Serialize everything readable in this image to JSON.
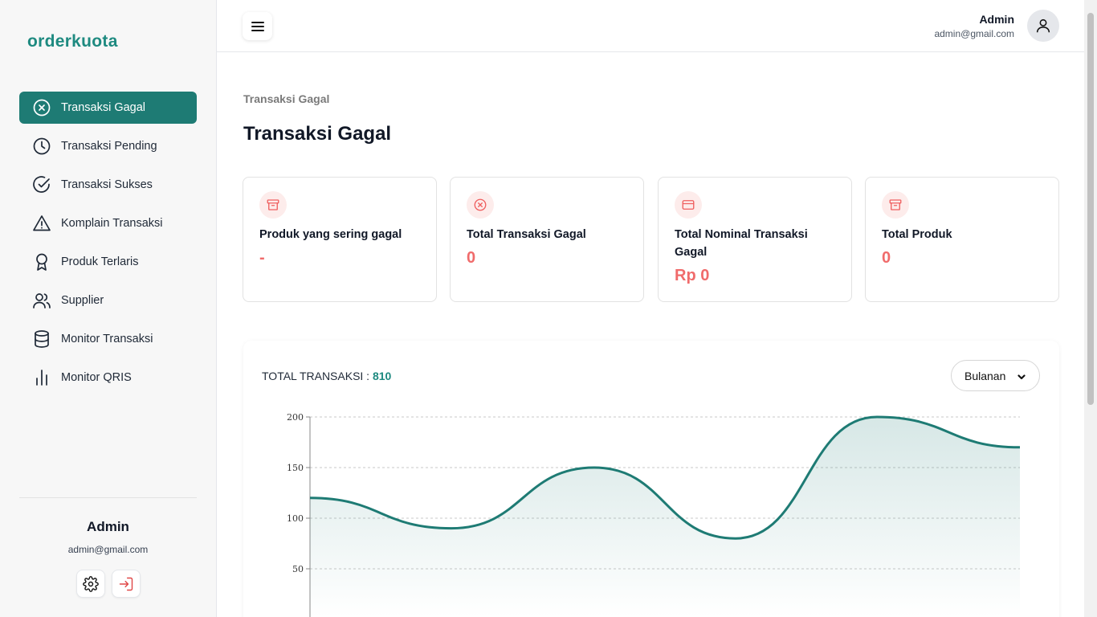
{
  "app": {
    "logo": "orderkuota"
  },
  "sidebar": {
    "items": [
      {
        "label": "Transaksi Gagal",
        "icon": "x-circle-icon",
        "active": true
      },
      {
        "label": "Transaksi Pending",
        "icon": "clock-icon",
        "active": false
      },
      {
        "label": "Transaksi Sukses",
        "icon": "check-circle-icon",
        "active": false
      },
      {
        "label": "Komplain Transaksi",
        "icon": "warning-triangle-icon",
        "active": false
      },
      {
        "label": "Produk Terlaris",
        "icon": "award-icon",
        "active": false
      },
      {
        "label": "Supplier",
        "icon": "users-icon",
        "active": false
      },
      {
        "label": "Monitor Transaksi",
        "icon": "database-icon",
        "active": false
      },
      {
        "label": "Monitor QRIS",
        "icon": "bar-chart-icon",
        "active": false
      }
    ],
    "user": {
      "name": "Admin",
      "email": "admin@gmail.com"
    },
    "accent": "#1e7b74"
  },
  "topbar": {
    "name": "Admin",
    "email": "admin@gmail.com"
  },
  "page": {
    "breadcrumb": "Transaksi Gagal",
    "title": "Transaksi Gagal"
  },
  "cards": [
    {
      "label": "Produk yang sering gagal",
      "value": "-",
      "icon": "archive-icon"
    },
    {
      "label": "Total Transaksi Gagal",
      "value": "0",
      "icon": "x-circle-icon"
    },
    {
      "label": "Total Nominal Transaksi Gagal",
      "value": "Rp 0",
      "icon": "credit-card-icon"
    },
    {
      "label": "Total Produk",
      "value": "0",
      "icon": "archive-icon"
    }
  ],
  "chart_section": {
    "title_prefix": "TOTAL TRANSAKSI : ",
    "total": "810",
    "period_select": "Bulanan"
  },
  "chart_data": {
    "type": "area",
    "x": [
      0,
      1,
      2,
      3,
      4,
      5,
      6
    ],
    "values": [
      120,
      90,
      150,
      80,
      200,
      170
    ],
    "series": [
      {
        "values": [
          120,
          90,
          150,
          80,
          200,
          170
        ]
      }
    ],
    "y_ticks": [
      "200",
      "150",
      "100",
      "50"
    ],
    "ylim": [
      0,
      200
    ],
    "grid": true,
    "line_color": "#1e7b74"
  }
}
